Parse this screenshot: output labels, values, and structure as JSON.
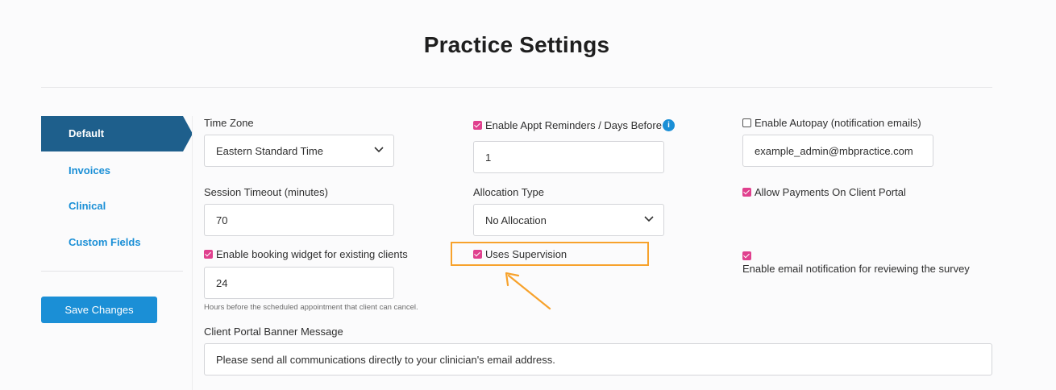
{
  "page": {
    "title": "Practice Settings"
  },
  "sidebar": {
    "items": [
      {
        "label": "Default",
        "active": true
      },
      {
        "label": "Invoices",
        "active": false
      },
      {
        "label": "Clinical",
        "active": false
      },
      {
        "label": "Custom Fields",
        "active": false
      }
    ],
    "save_label": "Save Changes"
  },
  "form": {
    "time_zone": {
      "label": "Time Zone",
      "value": "Eastern Standard Time"
    },
    "session_timeout": {
      "label": "Session Timeout (minutes)",
      "value": "70"
    },
    "booking_widget": {
      "label": "Enable booking widget for existing clients",
      "checked": true,
      "value": "24",
      "hint": "Hours before the scheduled appointment that client can cancel."
    },
    "appt_reminders": {
      "label": "Enable Appt Reminders / Days Before",
      "checked": true,
      "value": "1",
      "info_icon": "info-icon"
    },
    "allocation_type": {
      "label": "Allocation Type",
      "value": "No Allocation"
    },
    "uses_supervision": {
      "label": "Uses Supervision",
      "checked": true
    },
    "autopay": {
      "label": "Enable Autopay (notification emails)",
      "checked": false,
      "value": "example_admin@mbpractice.com"
    },
    "client_portal_payments": {
      "label": "Allow Payments On Client Portal",
      "checked": true
    },
    "survey_notification": {
      "label": "Enable email notification for reviewing the survey",
      "checked": true
    },
    "banner": {
      "label": "Client Portal Banner Message",
      "value": "Please send all communications directly to your clinician's email address."
    }
  },
  "colors": {
    "accent": "#1b8fd6",
    "nav_active": "#1e5f8c",
    "checkbox": "#e0408e",
    "highlight": "#f7a22c"
  }
}
